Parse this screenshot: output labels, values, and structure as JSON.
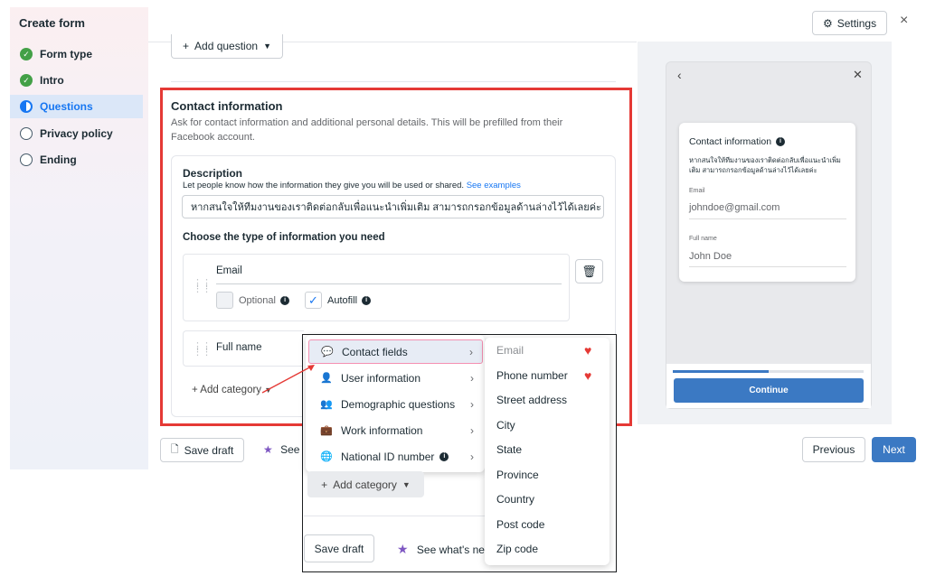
{
  "sidebar": {
    "title": "Create form",
    "steps": [
      {
        "label": "Form type",
        "state": "done"
      },
      {
        "label": "Intro",
        "state": "done"
      },
      {
        "label": "Questions",
        "state": "current"
      },
      {
        "label": "Privacy policy",
        "state": "todo"
      },
      {
        "label": "Ending",
        "state": "todo"
      }
    ]
  },
  "header": {
    "settings_label": "Settings",
    "close_glyph": "×"
  },
  "editor": {
    "add_question_label": "Add question",
    "contact": {
      "title": "Contact information",
      "description": "Ask for contact information and additional personal details. This will be prefilled from their Facebook account.",
      "desc_title": "Description",
      "desc_help": "Let people know how the information they give you will be used or shared.",
      "desc_link": "See examples",
      "desc_value": "หากสนใจให้ทีมงานของเราติดต่อกลับเพื่อแนะนำเพิ่มเติม สามารถกรอกข้อมูลด้านล่างไว้ได้เลยค่ะ",
      "choose_label": "Choose the type of information you need",
      "email_label": "Email",
      "optional_label": "Optional",
      "autofill_label": "Autofill",
      "fullname_label": "Full name",
      "add_category_label": "Add category"
    }
  },
  "footer": {
    "save_draft_label": "Save draft",
    "see_label": "See w",
    "previous_label": "Previous",
    "next_label": "Next"
  },
  "preview": {
    "card_title": "Contact information",
    "card_desc": "หากสนใจให้ทีมงานของเราติดต่อกลับเพื่อแนะนำเพิ่มเติม สามารถกรอกข้อมูลด้านล่างไว้ได้เลยค่ะ",
    "email_label": "Email",
    "email_value": "johndoe@gmail.com",
    "name_label": "Full name",
    "name_value": "John Doe",
    "continue_label": "Continue",
    "progress": 0.5
  },
  "callout": {
    "categories": [
      {
        "label": "Contact fields",
        "icon": "chat-bubbles-icon",
        "glyph": "💬",
        "highlighted": true
      },
      {
        "label": "User information",
        "icon": "person-icon",
        "glyph": "👤"
      },
      {
        "label": "Demographic questions",
        "icon": "people-icon",
        "glyph": "👥"
      },
      {
        "label": "Work information",
        "icon": "briefcase-icon",
        "glyph": "💼"
      },
      {
        "label": "National ID number",
        "icon": "globe-icon",
        "glyph": "🌐",
        "info": true
      }
    ],
    "add_category_label": "Add category",
    "save_draft_label": "Save draft",
    "see_label": "See what's ne",
    "fields": [
      {
        "label": "Email",
        "selected": true
      },
      {
        "label": "Phone number",
        "selected": true
      },
      {
        "label": "Street address"
      },
      {
        "label": "City"
      },
      {
        "label": "State"
      },
      {
        "label": "Province"
      },
      {
        "label": "Country"
      },
      {
        "label": "Post code"
      },
      {
        "label": "Zip code"
      }
    ]
  },
  "colors": {
    "accent": "#1877f2",
    "highlight_border": "#e53935",
    "primary_button": "#3b79c3"
  }
}
